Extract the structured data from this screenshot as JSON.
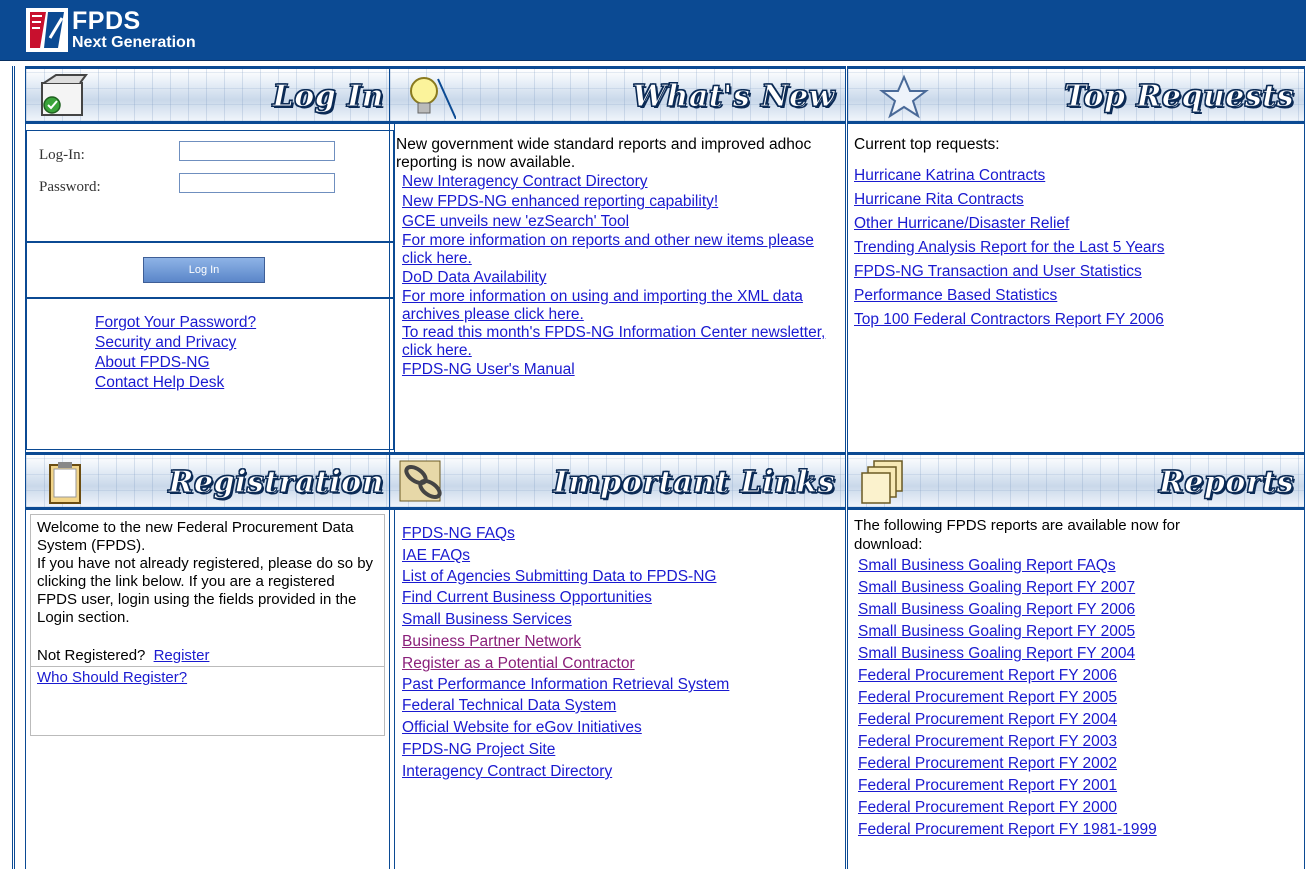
{
  "brand": {
    "title": "FPDS",
    "subtitle": "Next Generation",
    "colors": {
      "header_blue": "#0b4a93",
      "link": "#1a1ad0",
      "visited": "#8a1f7a"
    }
  },
  "login": {
    "header": "Log In",
    "icon": "clipboard-checkmark-icon",
    "login_label": "Log-In:",
    "password_label": "Password:",
    "login_value": "",
    "password_value": "",
    "button_label": "Log In",
    "links": [
      "Forgot Your Password?",
      "Security and Privacy",
      "About FPDS-NG",
      "Contact Help Desk"
    ]
  },
  "whats_new": {
    "header": "What's New",
    "icon": "lightbulb-icon",
    "intro": "New government wide standard reports and improved adhoc reporting is now available.",
    "links": [
      "New Interagency Contract Directory",
      "New FPDS-NG enhanced reporting capability!",
      "GCE unveils new 'ezSearch' Tool",
      "For more information on reports and other new items please click here.",
      "DoD Data Availability",
      "For more information on using and importing the XML data archives please click here.",
      "To read this month's FPDS-NG Information Center newsletter, click here.",
      "FPDS-NG User's Manual"
    ]
  },
  "top_requests": {
    "header": "Top Requests",
    "icon": "star-icon",
    "intro": "Current top requests:",
    "links": [
      "Hurricane Katrina Contracts",
      "Hurricane Rita Contracts",
      "Other Hurricane/Disaster Relief",
      "Trending Analysis Report for the Last 5 Years",
      "FPDS-NG Transaction and User Statistics",
      "Performance Based Statistics",
      "Top 100 Federal Contractors Report FY 2006"
    ]
  },
  "registration": {
    "header": "Registration",
    "icon": "clipboard-icon",
    "welcome": "Welcome to the new Federal Procurement Data System (FPDS).",
    "instructions": "If you have not already registered, please do so by clicking the link below. If you are a registered FPDS user, login using the fields provided in the Login section.",
    "not_registered": "Not Registered?",
    "register_link": "Register",
    "who_link": "Who Should Register?"
  },
  "important_links": {
    "header": "Important Links",
    "icon": "chain-link-icon",
    "links": [
      "FPDS-NG FAQs",
      "IAE FAQs",
      "List of Agencies Submitting Data to FPDS-NG",
      "Find Current Business Opportunities",
      "Small Business Services",
      "Business Partner Network",
      "Register as a Potential Contractor",
      "Past Performance Information Retrieval System",
      "Federal Technical Data System",
      "Official Website for eGov Initiatives",
      "FPDS-NG Project Site",
      "Interagency Contract Directory"
    ]
  },
  "reports": {
    "header": "Reports",
    "icon": "folders-icon",
    "intro": "The following FPDS reports are available now for download:",
    "links": [
      "Small Business Goaling Report FAQs",
      "Small Business Goaling Report FY 2007",
      "Small Business Goaling Report FY 2006",
      "Small Business Goaling Report FY 2005",
      "Small Business Goaling Report FY 2004",
      "Federal Procurement Report FY 2006",
      "Federal Procurement Report FY 2005",
      "Federal Procurement Report FY 2004",
      "Federal Procurement Report FY 2003",
      "Federal Procurement Report FY 2002",
      "Federal Procurement Report FY 2001",
      "Federal Procurement Report FY 2000",
      "Federal Procurement Report FY 1981-1999"
    ]
  }
}
